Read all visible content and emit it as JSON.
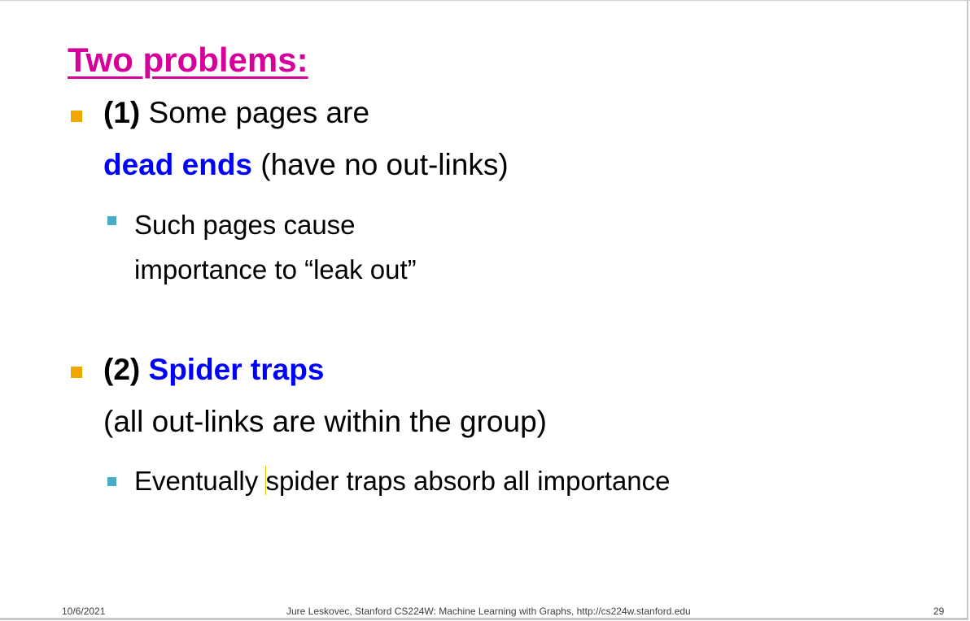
{
  "title": "Two problems:",
  "bullets": [
    {
      "number": "(1)",
      "line1_text": " Some pages are",
      "highlight": "dead ends",
      "line2_rest": " (have no out-links)",
      "sub": [
        "Such pages cause",
        "importance to “leak out”"
      ]
    },
    {
      "number": "(2)",
      "highlight": "Spider traps",
      "line2": "(all out-links are within the group)",
      "sub_before_cursor": "Eventually ",
      "sub_after_cursor": "spider traps absorb all importance"
    }
  ],
  "footer": {
    "date": "10/6/2021",
    "credit": "Jure Leskovec, Stanford CS224W: Machine Learning with Graphs, http://cs224w.stanford.edu",
    "page": "29"
  },
  "colors": {
    "title": "#d6009a",
    "highlight": "#0000ff",
    "bullet_l1": "#f0a800",
    "bullet_l2": "#4bacc6"
  }
}
